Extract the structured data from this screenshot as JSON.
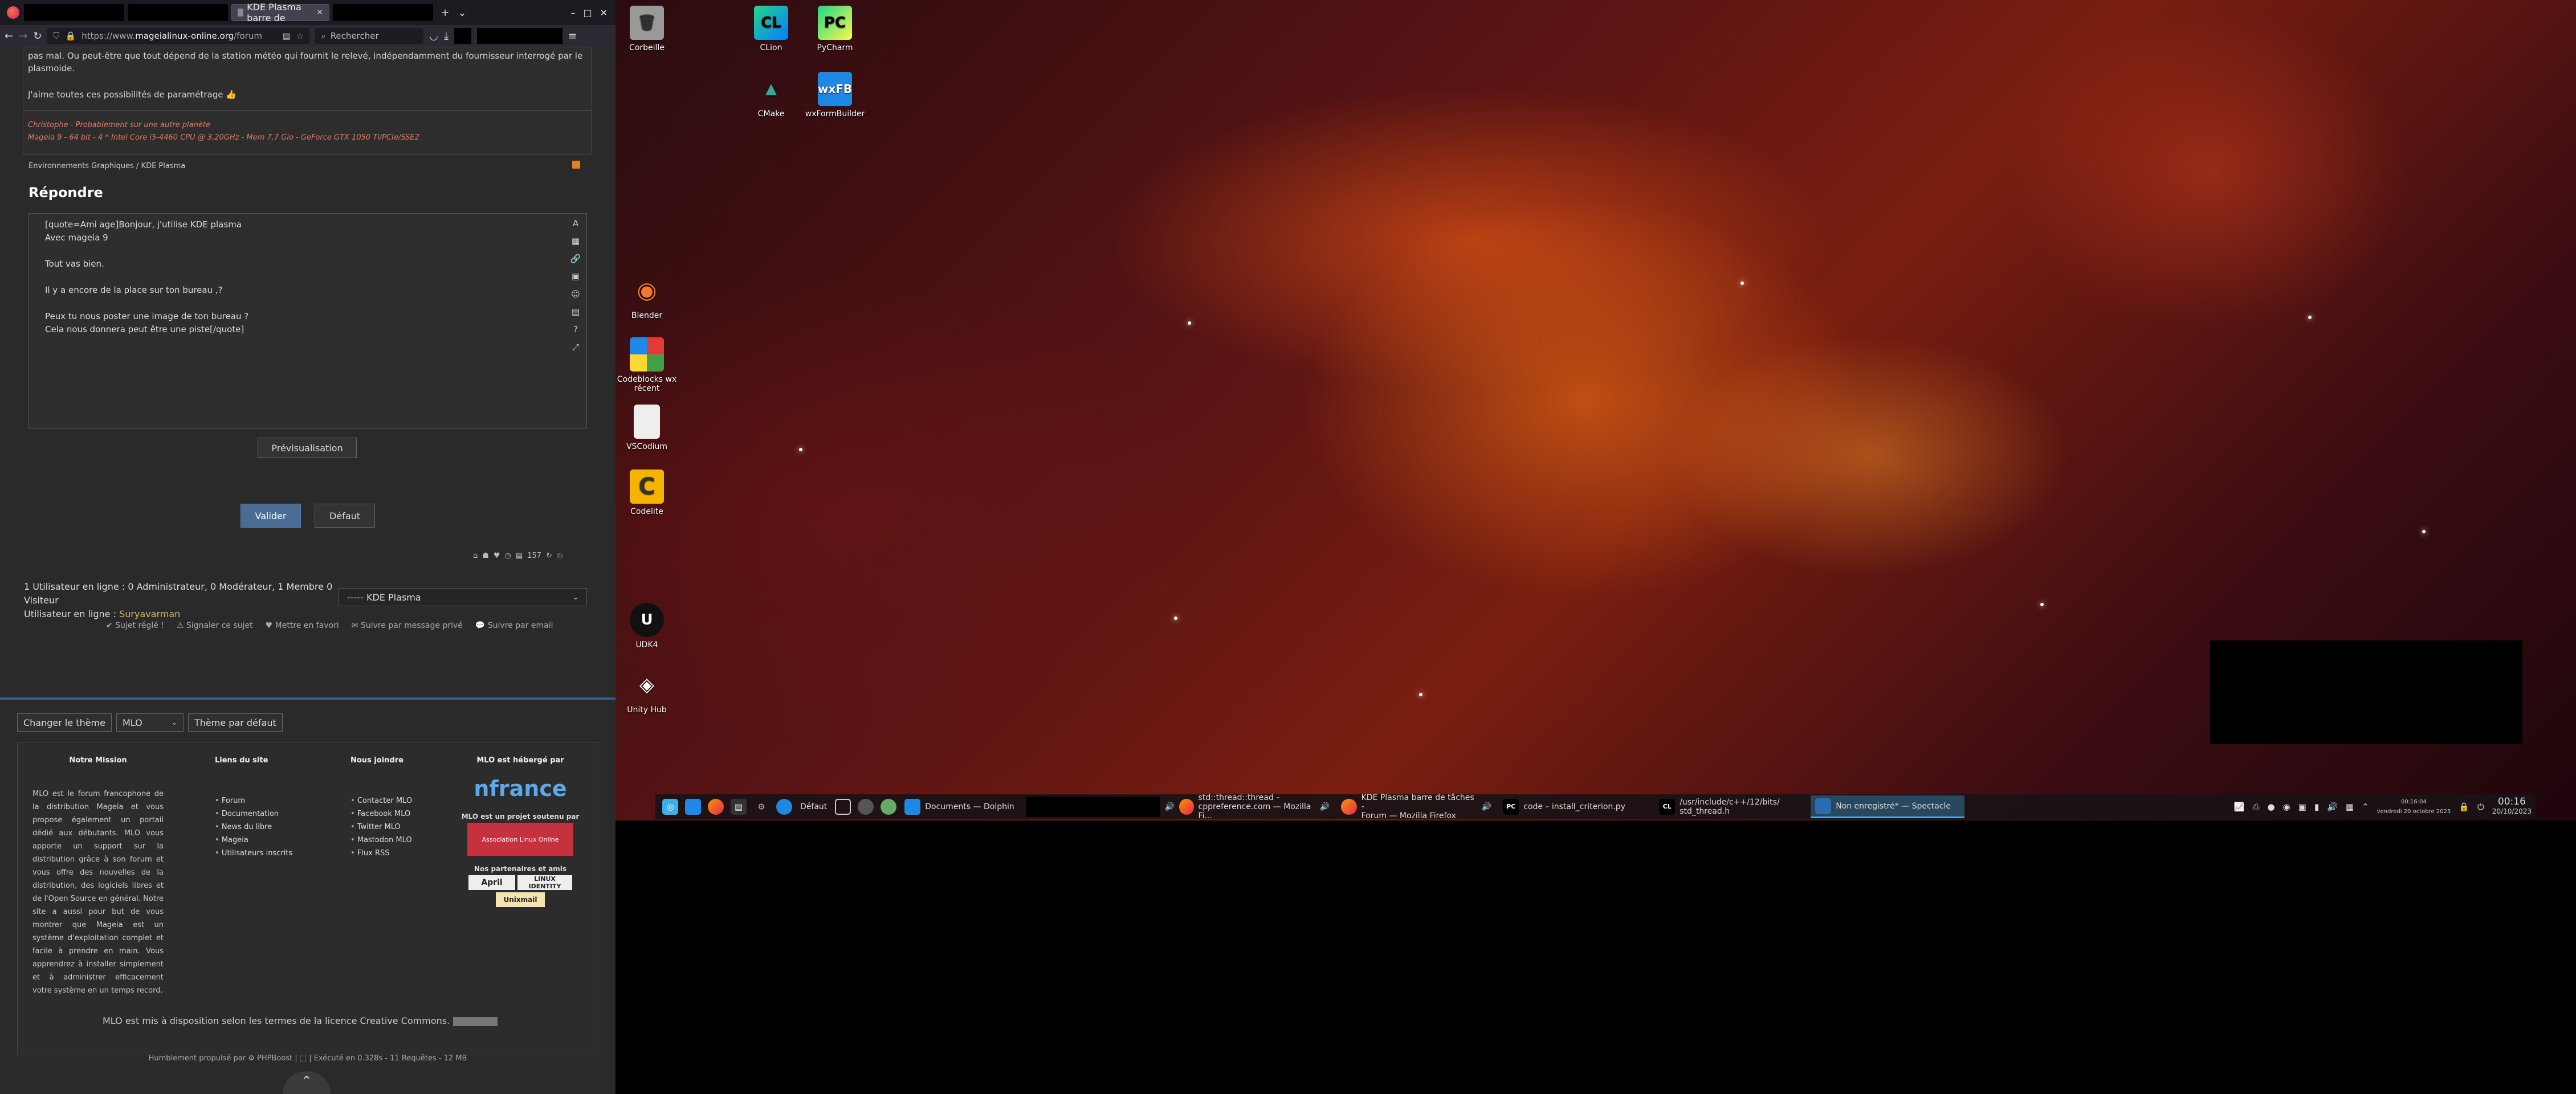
{
  "browser": {
    "tab_active_title": "KDE Plasma barre de",
    "url_prefix": "https://www.",
    "url_domain": "mageialinux-online.org",
    "url_suffix": "/forum",
    "search_placeholder": "Rechercher",
    "window_controls": [
      "⌄",
      "–",
      "□",
      "✕"
    ]
  },
  "post": {
    "line1": "pas mal. Ou peut-être que tout dépend de la station météo qui fournit le relevé, indépendamment du fournisseur interrogé par le plasmoide.",
    "line2": "J'aime toutes ces possibilités de paramétrage 👍",
    "signature_line1": "Christophe - Probablement sur une autre planète",
    "signature_line2": "Mageia 9 - 64 bit - 4 * Intel Core i5-4460 CPU @ 3,20GHz - Mem 7,7 Gio - GeForce GTX 1050 Ti/PCIe/SSE2"
  },
  "breadcrumbs": "Environnements Graphiques / KDE Plasma",
  "reply": {
    "heading": "Répondre",
    "editor_text": "[quote=Ami age]Bonjour, j'utilise KDE plasma\nAvec mageia 9\n\nTout vas bien.\n\nIl y a encore de la place sur ton bureau ,?\n\nPeux tu nous poster une image de ton bureau ?\nCela nous donnera peut être une piste[/quote]",
    "preview_button": "Prévisualisation",
    "submit_button": "Valider",
    "default_button": "Défaut",
    "tool_count": "157"
  },
  "online": {
    "line1": "1 Utilisateur en ligne : 0 Administrateur, 0 Modérateur, 1 Membre 0",
    "line2": "Visiteur",
    "line3_prefix": "Utilisateur en ligne : ",
    "line3_user": "Suryavarman",
    "jump_select": "----- KDE Plasma"
  },
  "actions": [
    "✔ Sujet réglé !",
    "⚠ Signaler ce sujet",
    "♥ Mettre en favori",
    "✉ Suivre par message privé",
    "💬 Suivre par email"
  ],
  "theme": {
    "change_button": "Changer le thème",
    "select_value": "MLO",
    "default_button": "Thème par défaut"
  },
  "footer": {
    "mission_title": "Notre Mission",
    "mission_text": "MLO est le forum francophone de la distribution Mageia et vous propose également un portail dédié aux débutants. MLO vous apporte un support sur la distribution grâce à son forum et vous offre des nouvelles de la distribution, des logiciels libres et de l'Open Source en général. Notre site a aussi pour but de vous montrer que Mageia est un système d'exploitation complet et facile à prendre en main. Vous apprendrez à installer simplement et à administrer efficacement votre système en un temps record.",
    "links_title": "Liens du site",
    "links": [
      "Forum",
      "Documentation",
      "News du libre",
      "Mageia",
      "Utilisateurs inscrits"
    ],
    "join_title": "Nous joindre",
    "join": [
      "Contacter MLO",
      "Facebook MLO",
      "Twitter MLO",
      "Mastodon MLO",
      "Flux RSS"
    ],
    "host_title": "MLO est hébergé par",
    "host_logo": "nfrance",
    "support_title": "MLO est un projet soutenu par",
    "support_logo": "Association Linux Online",
    "partners_title": "Nos partenaires et amis",
    "partner1": "April",
    "partner2": "LINUX IDENTITY",
    "partner3": "Unixmail"
  },
  "license": "MLO est mis à disposition selon les termes de la licence Creative Commons.",
  "powered": "Humblement propulsé par ⚙ PHPBoost | ⬚ | Exécuté en 0.328s - 11 Requêtes - 12 MB",
  "desktop_icons": {
    "trash": "Corbeille",
    "clion": "CLion",
    "pycharm": "PyCharm",
    "cmake": "CMake",
    "wxformbuilder": "wxFormBuilder",
    "blender": "Blender",
    "codeblocks": "Codeblocks wx récent",
    "vscodium": "VSCodium",
    "codelite": "Codelite",
    "udk4": "UDK4",
    "unityhub": "Unity Hub"
  },
  "taskbar": {
    "desktop_label": "Défaut",
    "task_dolphin": "Documents — Dolphin",
    "task_firefox1_l1": "std::thread::thread -",
    "task_firefox1_l2": "cppreference.com — Mozilla Fi...",
    "task_firefox2_l1": "KDE Plasma barre de tâches -",
    "task_firefox2_l2": "Forum — Mozilla Firefox",
    "task_pycharm": "code – install_criterion.py",
    "task_clion_l1": "/usr/include/c++/12/bits/",
    "task_clion_l2": "std_thread.h",
    "task_spectacle": "Non enregistré* — Spectacle",
    "tray_time_small": "00:16:04",
    "tray_date_small": "vendredi 20 octobre 2023",
    "clock_time": "00:16",
    "clock_date": "20/10/2023"
  }
}
